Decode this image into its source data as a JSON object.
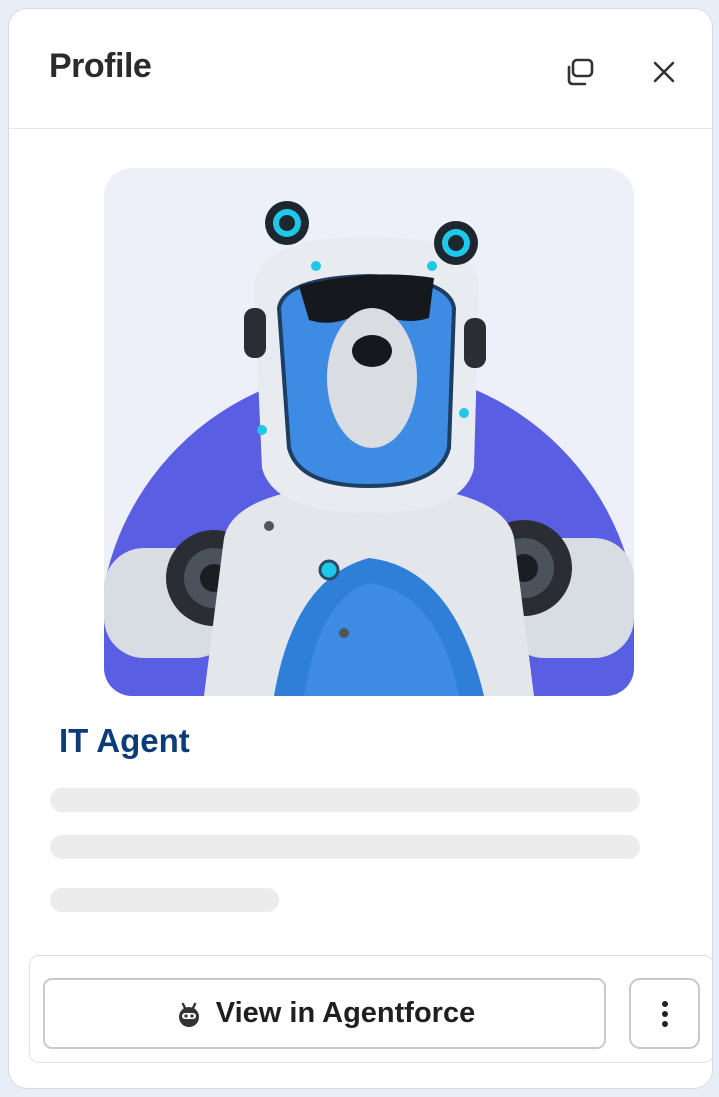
{
  "header": {
    "title": "Profile",
    "popout_icon": "popout-icon",
    "close_icon": "close-icon"
  },
  "agent": {
    "name": "IT Agent",
    "avatar_description_icon": "robot-bear-avatar"
  },
  "actions": {
    "primary_label": "View in Agentforce",
    "primary_icon": "agentforce-icon",
    "more_icon": "more-vertical-icon"
  },
  "colors": {
    "name_color": "#0b3c78",
    "avatar_circle": "#5a5ee3",
    "avatar_blue": "#3d8be3"
  }
}
